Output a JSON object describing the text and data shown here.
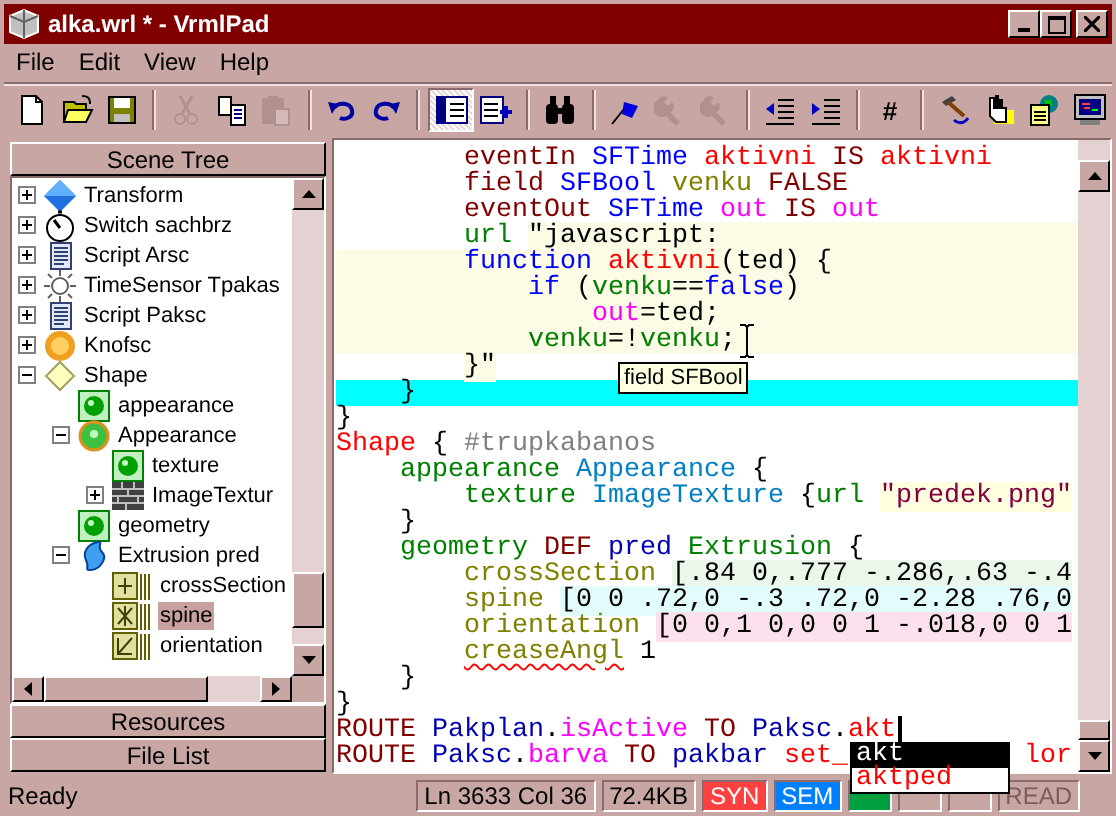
{
  "window": {
    "title": "alka.wrl * - VrmlPad"
  },
  "menu": [
    "File",
    "Edit",
    "View",
    "Help"
  ],
  "toolbar": {
    "groups": [
      [
        {
          "kind": "new-file",
          "disabled": false,
          "pressed": false
        },
        {
          "kind": "open-folder",
          "disabled": false,
          "pressed": false
        },
        {
          "kind": "save",
          "disabled": false,
          "pressed": false
        }
      ],
      [
        {
          "kind": "cut",
          "disabled": true,
          "pressed": false
        },
        {
          "kind": "copy",
          "disabled": false,
          "pressed": false
        },
        {
          "kind": "paste",
          "disabled": true,
          "pressed": false
        }
      ],
      [
        {
          "kind": "undo",
          "disabled": false,
          "pressed": false
        },
        {
          "kind": "redo",
          "disabled": false,
          "pressed": false
        }
      ],
      [
        {
          "kind": "tree-panel",
          "disabled": false,
          "pressed": true
        },
        {
          "kind": "list-add",
          "disabled": false,
          "pressed": false
        }
      ],
      [
        {
          "kind": "find",
          "disabled": false,
          "pressed": false
        }
      ],
      [
        {
          "kind": "flag",
          "disabled": false,
          "pressed": false
        },
        {
          "kind": "wrench",
          "disabled": true,
          "pressed": false
        },
        {
          "kind": "wrench",
          "disabled": true,
          "pressed": false
        }
      ],
      [
        {
          "kind": "outdent",
          "disabled": false,
          "pressed": false
        },
        {
          "kind": "indent",
          "disabled": false,
          "pressed": false
        }
      ],
      [
        {
          "label": "#",
          "disabled": false,
          "pressed": false
        }
      ],
      [
        {
          "kind": "hammer",
          "disabled": false,
          "pressed": false
        },
        {
          "kind": "hand",
          "disabled": false,
          "pressed": false
        },
        {
          "kind": "globe-page",
          "disabled": false,
          "pressed": false
        },
        {
          "kind": "monitor",
          "disabled": false,
          "pressed": false
        }
      ]
    ]
  },
  "left_panel": {
    "tabs_top": [
      "Scene Tree"
    ],
    "tree": {
      "items": [
        {
          "label": "Transform",
          "kind": "transform",
          "expanded": false,
          "selected": false
        },
        {
          "label": "Switch sachbrz",
          "kind": "switch",
          "expanded": false,
          "selected": false
        },
        {
          "label": "Script Arsc",
          "kind": "script",
          "expanded": false,
          "selected": false
        },
        {
          "label": "TimeSensor Tpakas",
          "kind": "timesensor",
          "expanded": false,
          "selected": false
        },
        {
          "label": "Script Paksc",
          "kind": "script",
          "expanded": false,
          "selected": false
        },
        {
          "label": "Knofsc",
          "kind": "proto",
          "expanded": false,
          "selected": false
        },
        {
          "label": "Shape",
          "kind": "shape",
          "expanded": true,
          "selected": false,
          "children": [
            {
              "label": "appearance",
              "kind": "field",
              "selected": false
            },
            {
              "label": "Appearance",
              "kind": "appearance",
              "expanded": true,
              "selected": false,
              "children": [
                {
                  "label": "texture",
                  "kind": "field",
                  "selected": false
                },
                {
                  "label": "ImageTextur",
                  "kind": "imagetexture",
                  "expanded": false,
                  "selected": false
                }
              ]
            },
            {
              "label": "geometry",
              "kind": "field",
              "selected": false
            },
            {
              "label": "Extrusion pred",
              "kind": "extrusion",
              "expanded": true,
              "selected": false,
              "children": [
                {
                  "label": "crossSection",
                  "kind": "mfvec2",
                  "selected": false
                },
                {
                  "label": "spine",
                  "kind": "mfvec3",
                  "selected": true
                },
                {
                  "label": "orientation",
                  "kind": "mfrotation",
                  "selected": false
                }
              ]
            }
          ]
        }
      ]
    },
    "tabs_bottom": [
      "Resources",
      "File List"
    ]
  },
  "editor": {
    "lines": [
      {
        "kind": "normal",
        "tokens": [
          {
            "t": "        eventIn ",
            "kind": "keyword"
          },
          {
            "t": "SFTime ",
            "kind": "type"
          },
          {
            "t": "aktivni ",
            "kind": "name"
          },
          {
            "t": "IS ",
            "kind": "keyword"
          },
          {
            "t": "aktivni",
            "kind": "name"
          }
        ]
      },
      {
        "kind": "normal",
        "tokens": [
          {
            "t": "        field ",
            "kind": "keyword"
          },
          {
            "t": "SFBool ",
            "kind": "type"
          },
          {
            "t": "venku ",
            "kind": "field"
          },
          {
            "t": "FALSE",
            "kind": "keyword"
          }
        ]
      },
      {
        "kind": "normal",
        "tokens": [
          {
            "t": "        eventOut ",
            "kind": "keyword"
          },
          {
            "t": "SFTime ",
            "kind": "type"
          },
          {
            "t": "out ",
            "kind": "event"
          },
          {
            "t": "IS ",
            "kind": "keyword"
          },
          {
            "t": "out",
            "kind": "event"
          }
        ]
      },
      {
        "kind": "script_start",
        "tokens": [
          {
            "t": "        url ",
            "kind": "js"
          },
          {
            "t": "\"javascript:",
            "kind": "script"
          }
        ]
      },
      {
        "kind": "script",
        "tokens": [
          {
            "t": "        function ",
            "kind": "type"
          },
          {
            "t": "aktivni",
            "kind": "name"
          },
          {
            "t": "(ted) {",
            "kind": "plain"
          }
        ]
      },
      {
        "kind": "script",
        "tokens": [
          {
            "t": "            if ",
            "kind": "type"
          },
          {
            "t": "(",
            "kind": "plain"
          },
          {
            "t": "venku",
            "kind": "js"
          },
          {
            "t": "==",
            "kind": "plain"
          },
          {
            "t": "false",
            "kind": "type"
          },
          {
            "t": ")",
            "kind": "plain"
          }
        ]
      },
      {
        "kind": "script",
        "tokens": [
          {
            "t": "                out",
            "kind": "event"
          },
          {
            "t": "=ted;",
            "kind": "plain"
          }
        ]
      },
      {
        "kind": "script",
        "tokens": [
          {
            "t": "            venku",
            "kind": "js"
          },
          {
            "t": "=!",
            "kind": "plain"
          },
          {
            "t": "venku",
            "kind": "js"
          },
          {
            "t": ";",
            "kind": "plain"
          }
        ]
      },
      {
        "kind": "normal",
        "tokens": [
          {
            "t": "        }\"",
            "kind": "script"
          }
        ]
      },
      {
        "kind": "current",
        "tokens": [
          {
            "t": "    }",
            "kind": "plain"
          }
        ]
      },
      {
        "kind": "normal",
        "tokens": [
          {
            "t": "}",
            "kind": "plain"
          }
        ]
      },
      {
        "kind": "normal",
        "tokens": [
          {
            "t": "Shape ",
            "kind": "node"
          },
          {
            "t": "{ ",
            "kind": "plain"
          },
          {
            "t": "#trupkabanos",
            "kind": "comment"
          }
        ]
      },
      {
        "kind": "normal",
        "tokens": [
          {
            "t": "    appearance ",
            "kind": "js"
          },
          {
            "t": "Appearance ",
            "kind": "class"
          },
          {
            "t": "{",
            "kind": "plain"
          }
        ]
      },
      {
        "kind": "normal",
        "tokens": [
          {
            "t": "        texture ",
            "kind": "js"
          },
          {
            "t": "ImageTexture ",
            "kind": "class"
          },
          {
            "t": "{",
            "kind": "plain"
          },
          {
            "t": "url ",
            "kind": "js"
          },
          {
            "t": "\"predek.png\"",
            "kind": "string"
          }
        ]
      },
      {
        "kind": "normal",
        "tokens": [
          {
            "t": "    }",
            "kind": "plain"
          }
        ]
      },
      {
        "kind": "normal",
        "tokens": [
          {
            "t": "    geometry ",
            "kind": "js"
          },
          {
            "t": "DEF ",
            "kind": "keyword"
          },
          {
            "t": "pred ",
            "kind": "def"
          },
          {
            "t": "Extrusion ",
            "kind": "js"
          },
          {
            "t": "{",
            "kind": "plain"
          }
        ]
      },
      {
        "kind": "normal",
        "tokens": [
          {
            "t": "        crossSection ",
            "kind": "field"
          },
          {
            "t": "[.84 0,.777 -.286,.63 -.4",
            "kind": "mfvec2"
          }
        ]
      },
      {
        "kind": "normal",
        "tokens": [
          {
            "t": "        spine ",
            "kind": "field"
          },
          {
            "t": "[0 0 .72,0 -.3 .72,0 -2.28 .76,0",
            "kind": "mfvec3"
          }
        ]
      },
      {
        "kind": "normal",
        "tokens": [
          {
            "t": "        orientation ",
            "kind": "field"
          },
          {
            "t": "[0 0,1 0,0 0 1 -.018,0 0 1",
            "kind": "mfrotation"
          }
        ]
      },
      {
        "kind": "normal",
        "tokens": [
          {
            "t": "        creaseAngl",
            "kind": "field",
            "error": true
          },
          {
            "t": " 1",
            "kind": "plain",
            "error": false
          }
        ]
      },
      {
        "kind": "normal",
        "tokens": [
          {
            "t": "    }",
            "kind": "plain"
          }
        ]
      },
      {
        "kind": "normal",
        "tokens": [
          {
            "t": "}",
            "kind": "plain"
          }
        ]
      },
      {
        "kind": "normal",
        "tokens": [
          {
            "t": "ROUTE ",
            "kind": "keyword"
          },
          {
            "t": "Pakplan",
            "kind": "def"
          },
          {
            "t": ".",
            "kind": "plain"
          },
          {
            "t": "isActive ",
            "kind": "event"
          },
          {
            "t": "TO ",
            "kind": "keyword"
          },
          {
            "t": "Paksc",
            "kind": "def"
          },
          {
            "t": ".",
            "kind": "plain"
          },
          {
            "t": "akt",
            "kind": "name"
          }
        ]
      },
      {
        "kind": "normal",
        "tokens": [
          {
            "t": "ROUTE ",
            "kind": "keyword"
          },
          {
            "t": "Paksc",
            "kind": "def"
          },
          {
            "t": ".",
            "kind": "plain"
          },
          {
            "t": "barva ",
            "kind": "event"
          },
          {
            "t": "TO ",
            "kind": "keyword"
          },
          {
            "t": "pakbar ",
            "kind": "def"
          },
          {
            "t": "set_           ",
            "kind": "name"
          },
          {
            "t": "lor",
            "kind": "name"
          }
        ]
      }
    ],
    "tooltip": "field SFBool",
    "autocomplete": [
      {
        "label": "akt",
        "selected": true
      },
      {
        "label": "aktped",
        "selected": false
      }
    ]
  },
  "status_bar": {
    "message": "Ready",
    "panes": [
      {
        "text": "Ln 3633 Col 36",
        "kind": "plain"
      },
      {
        "text": "72.4KB",
        "kind": "plain"
      },
      {
        "text": "SYN",
        "kind": "syntax"
      },
      {
        "text": "SEM",
        "kind": "semantic"
      },
      {
        "kind": "ok"
      },
      {
        "kind": "plain"
      },
      {
        "kind": "plain"
      },
      {
        "text": "READ",
        "kind": "disabled"
      }
    ]
  }
}
